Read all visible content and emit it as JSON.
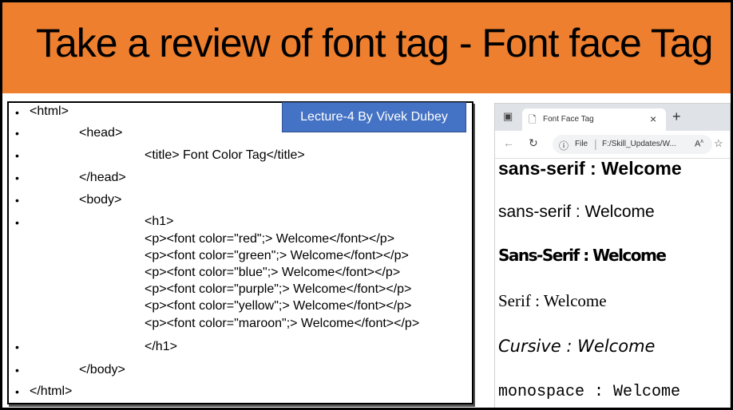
{
  "slide": {
    "title": "Take a review of font tag - Font face Tag",
    "badge": "Lecture-4 By Vivek Dubey"
  },
  "code_lines": [
    "<html>",
    "<head>",
    "<title> Font Color Tag</title>",
    "</head>",
    "<body>",
    "<h1>",
    "<p><font color=\"red\";> Welcome</font></p>",
    "<p><font color=\"green\";> Welcome</font></p>",
    "<p><font color=\"blue\";> Welcome</font></p>",
    "<p><font color=\"purple\";> Welcome</font></p>",
    "<p><font color=\"yellow\";> Welcome</font></p>",
    "<p><font color=\"maroon\";> Welcome</font></p>",
    "</h1>",
    "</body>",
    "</html>"
  ],
  "browser": {
    "tab_title": "Font Face Tag",
    "tab_close": "×",
    "new_tab": "+",
    "url_label": "File",
    "url_path": "F:/Skill_Updates/W...",
    "read_aloud": "A",
    "read_aloud_sup": "ʌ",
    "icons": [
      "window-icon",
      "page-icon",
      "back-icon",
      "reload-icon",
      "info-icon",
      "favorite-icon"
    ]
  },
  "demo_lines": [
    "sans-serif : Welcome",
    "sans-serif : Welcome",
    "Sans-Serif : Welcome",
    "Serif : Welcome",
    "Cursive : Welcome",
    "monospace : Welcome"
  ],
  "colors": {
    "banner": "#ee7f2f",
    "badge": "#4472c4",
    "badge_text": "#ffffff"
  }
}
